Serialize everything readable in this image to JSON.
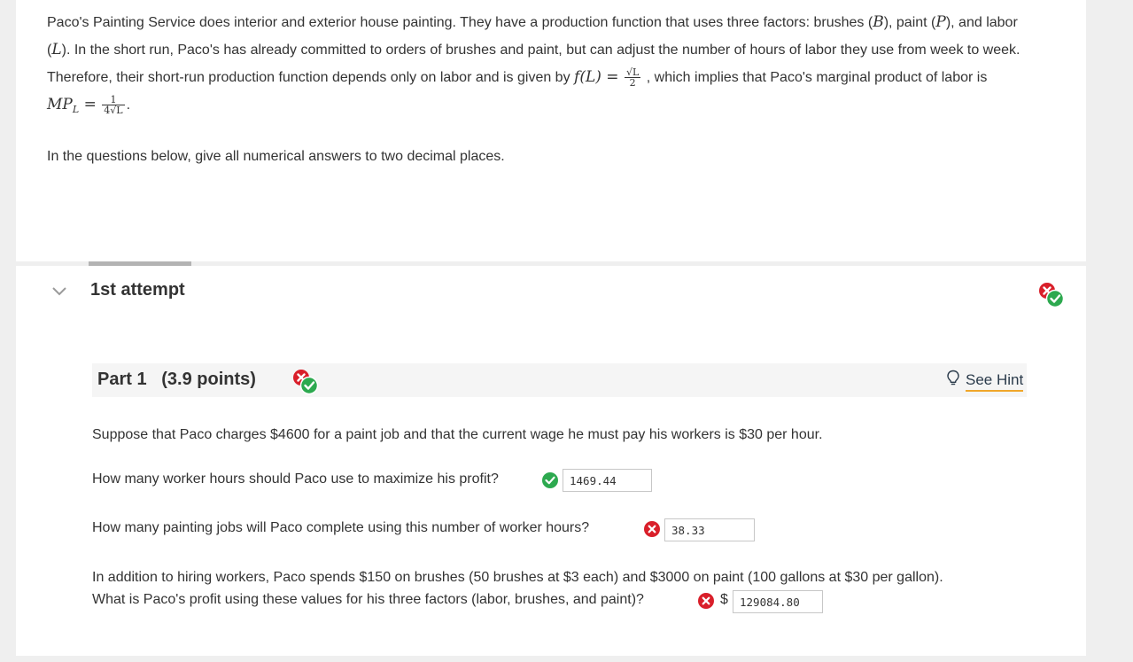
{
  "intro": {
    "p1": "Paco's Painting Service does interior and exterior house painting. They have a production function that uses three factors: brushes (",
    "B": "B",
    "p2": "), paint (",
    "P": "P",
    "p3": "), and labor (",
    "L": "L",
    "p4": "). In the short run, Paco's has already committed to orders of brushes and paint, but can adjust the number of hours of labor they use from week to week. Therefore, their short-run production function depends only on labor and is given by ",
    "f_of_L": "f(L) =",
    "f_num": "√L",
    "f_den": "2",
    "p5": ", which implies that Paco's marginal product of labor is ",
    "mpl": "MP",
    "mpl_sub": "L",
    "mpl_eq": " =",
    "mpl_num": "1",
    "mpl_den": "4√L",
    "p6": "."
  },
  "instructions": "In the questions below, give all numerical answers to two decimal places.",
  "attempt": {
    "title": "1st attempt"
  },
  "part": {
    "label": "Part 1   (3.9 points)",
    "hint_label": "See Hint"
  },
  "questions": {
    "setup": "Suppose that Paco charges $4600 for a paint job and that the current wage he must pay his workers is $30 per hour.",
    "q1": "How many worker hours should Paco use to maximize his profit?",
    "q1_answer": "1469.44",
    "q2": "How many painting jobs will Paco complete using this number of worker hours?",
    "q2_answer": "38.33",
    "q3_line1": "In addition to hiring workers, Paco spends $150 on brushes (50 brushes at $3 each) and $3000 on paint (100 gallons at $30 per gallon).",
    "q3_line2": "What is Paco's profit using these values for his three factors (labor, brushes, and paint)?",
    "q3_currency": "$",
    "q3_answer": "129084.80"
  },
  "colors": {
    "correct": "#2da94f",
    "incorrect": "#d91f2a",
    "hint_underline": "#f0a72a"
  }
}
